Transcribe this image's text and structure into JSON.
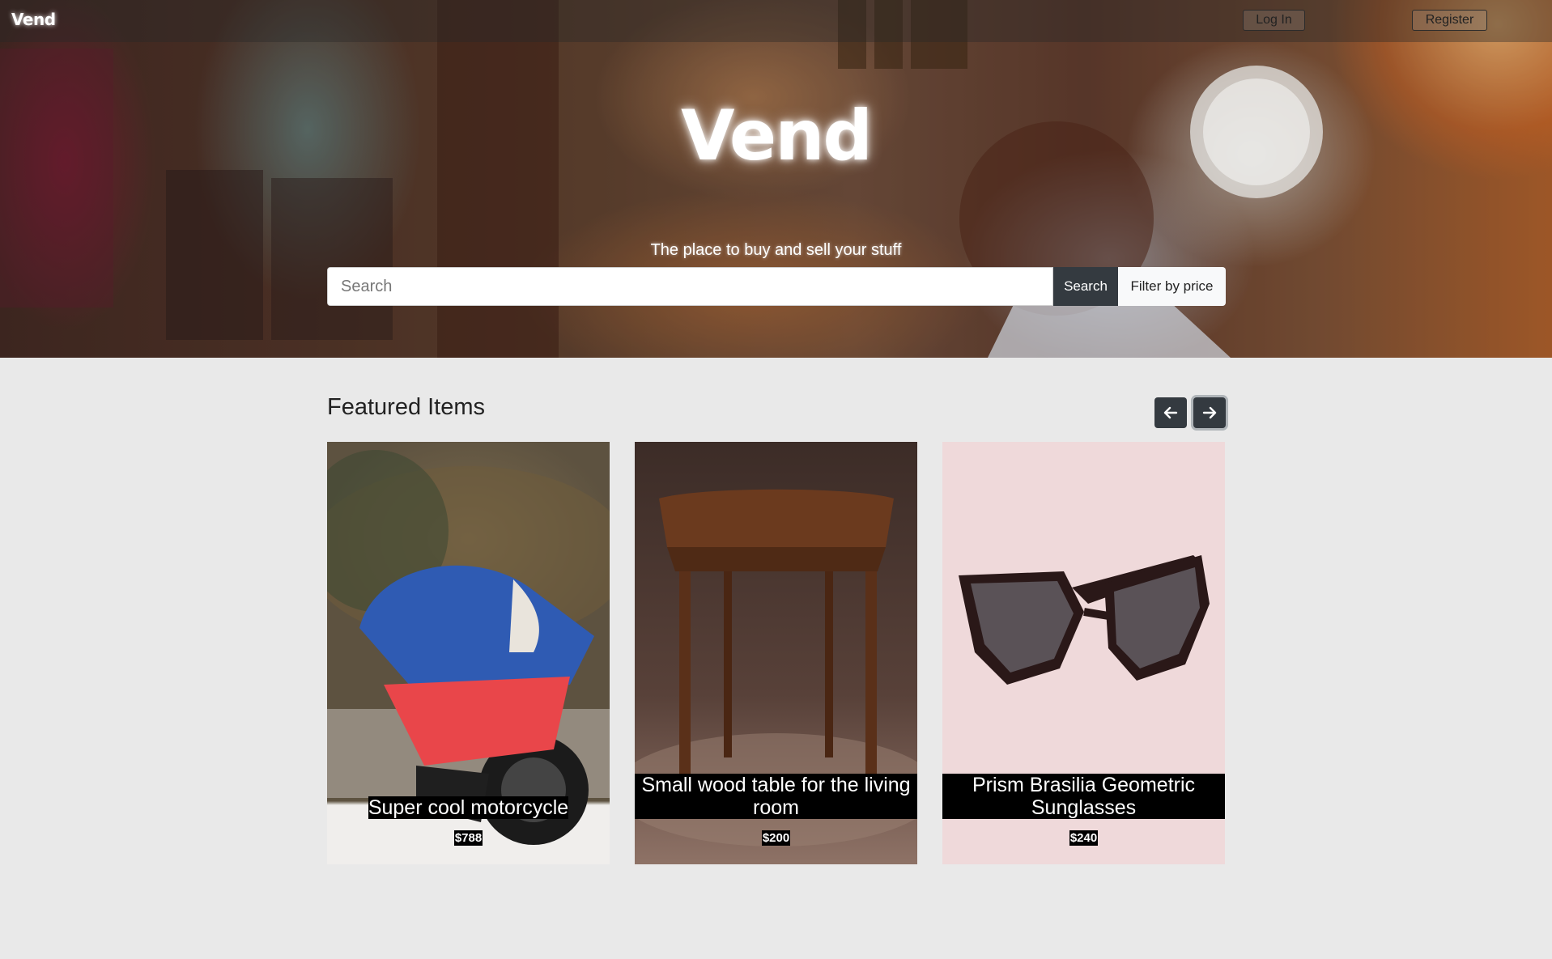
{
  "brand": "Vend",
  "nav": {
    "login_label": "Log In",
    "register_label": "Register"
  },
  "hero": {
    "title": "Vend",
    "subtitle": "The place to buy and sell your stuff"
  },
  "search": {
    "placeholder": "Search",
    "value": "",
    "search_button_label": "Search",
    "filter_button_label": "Filter by price"
  },
  "featured": {
    "title": "Featured Items",
    "prev_icon": "arrow-left-icon",
    "next_icon": "arrow-right-icon",
    "items": [
      {
        "title": "Super cool motorcycle",
        "price": "$788",
        "image": "motorcycle-photo"
      },
      {
        "title": "Small wood table for the living room",
        "price": "$200",
        "image": "wood-table-photo"
      },
      {
        "title": "Prism Brasilia Geometric Sunglasses",
        "price": "$240",
        "image": "sunglasses-photo"
      }
    ]
  },
  "colors": {
    "page_background": "#e9e9e9",
    "dark_button": "#343a40",
    "light_button": "#f8f9fa",
    "sunglasses_card_background": "#efd9da"
  }
}
